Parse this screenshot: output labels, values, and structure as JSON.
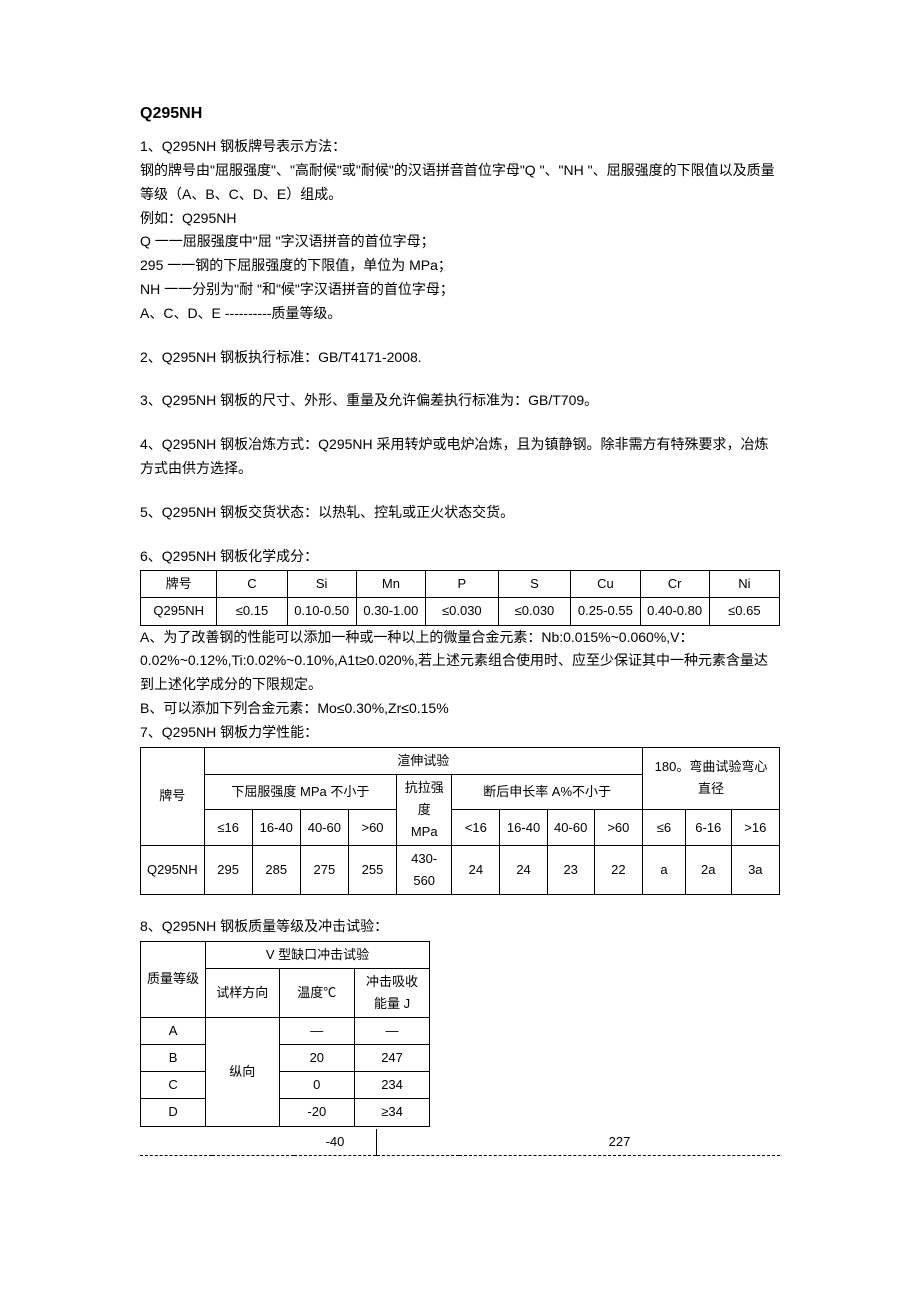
{
  "title": "Q295NH",
  "sec1": {
    "heading": "1、Q295NH 钢板牌号表示方法：",
    "p1": "钢的牌号由\"屈服强度\"、\"高耐候\"或\"耐候\"的汉语拼音首位字母\"Q \"、\"NH \"、屈服强度的下限值以及质量等级（A、B、C、D、E）组成。",
    "p2": "例如：Q295NH",
    "p3": "Q 一一屈服强度中\"屈 \"字汉语拼音的首位字母；",
    "p4": "295 一一钢的下屈服强度的下限值，单位为 MPa；",
    "p5": "NH 一一分别为\"耐 \"和\"候\"字汉语拼音的首位字母；",
    "p6": "A、C、D、E ----------质量等级。"
  },
  "sec2": "2、Q295NH 钢板执行标准：GB/T4171-2008.",
  "sec3": "3、Q295NH 钢板的尺寸、外形、重量及允许偏差执行标准为：GB/T709。",
  "sec4": "4、Q295NH 钢板冶炼方式：Q295NH 采用转炉或电炉冶炼，且为镇静钢。除非需方有特殊要求，冶炼方式由供方选择。",
  "sec5": "5、Q295NH 钢板交货状态：以热轧、控轧或正火状态交货。",
  "sec6": {
    "heading": "6、Q295NH 钢板化学成分：",
    "headers": [
      "牌号",
      "C",
      "Si",
      "Mn",
      "P",
      "S",
      "Cu",
      "Cr",
      "Ni"
    ],
    "row": [
      "Q295NH",
      "≤0.15",
      "0.10-0.50",
      "0.30-1.00",
      "≤0.030",
      "≤0.030",
      "0.25-0.55",
      "0.40-0.80",
      "≤0.65"
    ],
    "note1": "A、为了改善钢的性能可以添加一种或一种以上的微量合金元素：Nb:0.015%~0.060%,V：",
    "note2": "0.02%~0.12%,Ti:0.02%~0.10%,A1t≥0.020%,若上述元素组合使用时、应至少保证其中一种元素含量达到上述化学成分的下限规定。",
    "note3": "B、可以添加下列合金元素：Mo≤0.30%,Zr≤0.15%"
  },
  "sec7": {
    "heading": "7、Q295NH 钢板力学性能：",
    "h_grade": "牌号",
    "h_tensile": "渲伸试验",
    "h_bend": "180。弯曲试验弯心直径",
    "h_yield": "下屈服强度 MPa 不小于",
    "h_tensile_str": "抗拉强度 MPa",
    "h_elong": "断后申长率 A%不小于",
    "y_cols": [
      "≤16",
      "16-40",
      "40-60",
      ">60"
    ],
    "e_cols": [
      "<16",
      "16-40",
      "40-60",
      ">60"
    ],
    "b_cols": [
      "≤6",
      "6-16",
      ">16"
    ],
    "row": {
      "grade": "Q295NH",
      "yield": [
        "295",
        "285",
        "275",
        "255"
      ],
      "tensile": "430-560",
      "elong": [
        "24",
        "24",
        "23",
        "22"
      ],
      "bend": [
        "a",
        "2a",
        "3a"
      ]
    }
  },
  "sec8": {
    "heading": "8、Q295NH 钢板质量等级及冲击试验：",
    "h_grade": "质量等级",
    "h_impact": "V 型缺口冲击试验",
    "h_dir": "试样方向",
    "h_temp": "温度℃",
    "h_energy": "冲击吸收能量 J",
    "dir": "纵向",
    "rows": [
      {
        "g": "A",
        "t": "—",
        "e": "—"
      },
      {
        "g": "B",
        "t": "20",
        "e": "247"
      },
      {
        "g": "C",
        "t": "0",
        "e": "234"
      },
      {
        "g": "D",
        "t": "-20",
        "e": "≥34"
      }
    ],
    "last_t": "-40",
    "last_e": "227"
  }
}
